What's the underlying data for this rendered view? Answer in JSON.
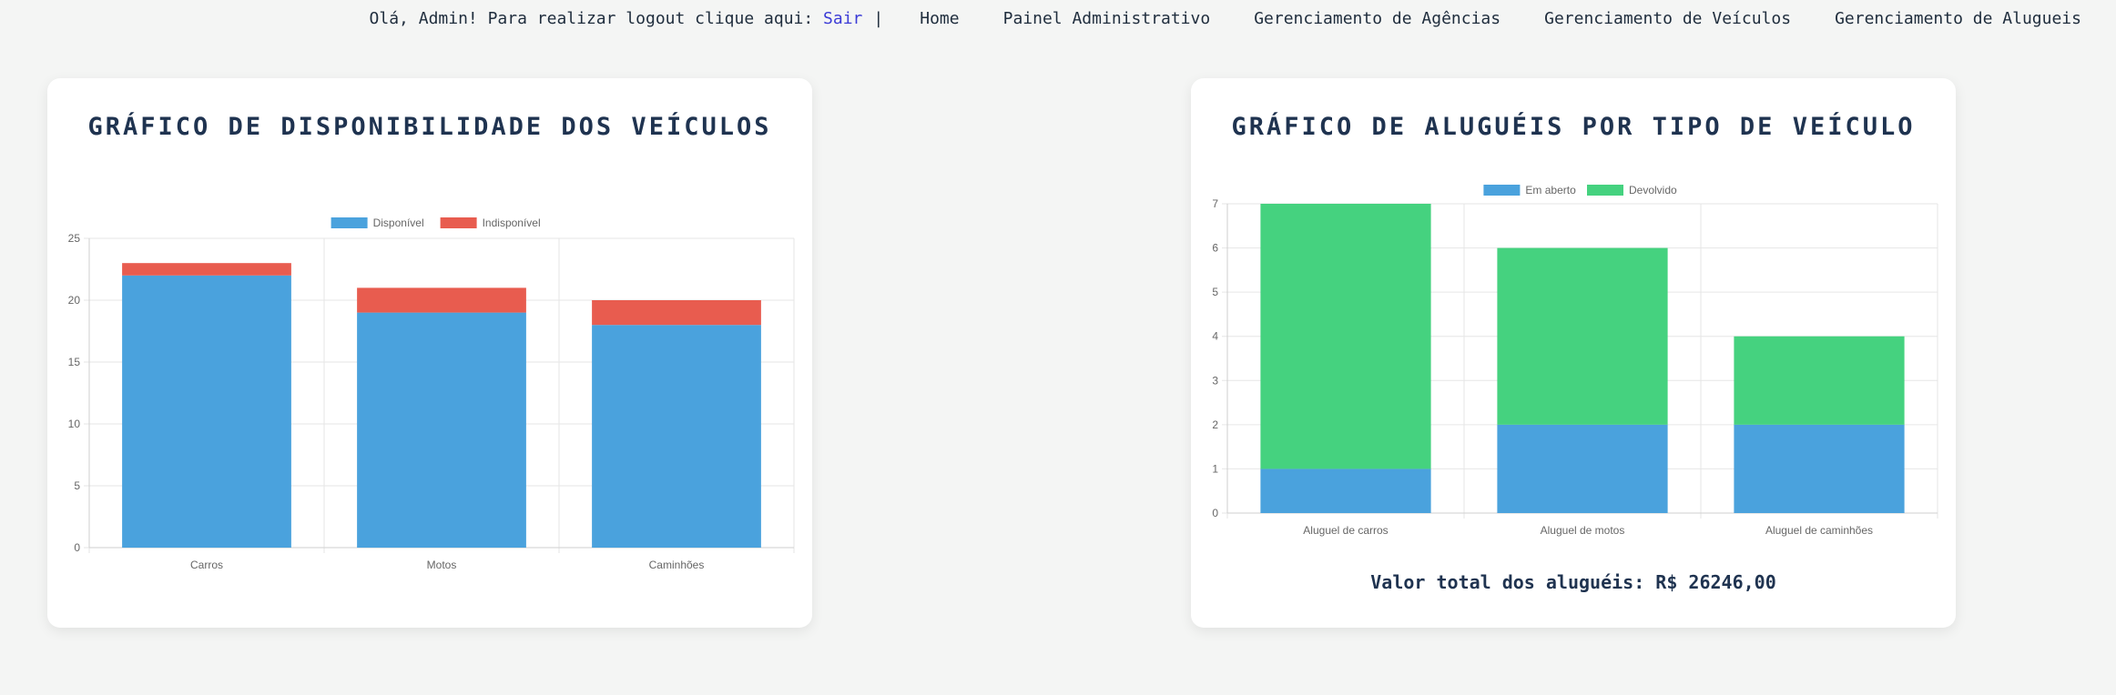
{
  "header": {
    "greeting": "Olá, Admin! Para realizar logout clique aqui: ",
    "logout_label": "Sair",
    "separator": "|",
    "nav": [
      "Home",
      "Painel Administrativo",
      "Gerenciamento de Agências",
      "Gerenciamento de Veículos",
      "Gerenciamento de Alugueis"
    ]
  },
  "colors": {
    "blue": "#4aa2dd",
    "red": "#e85c4f",
    "green": "#45d27f",
    "background": "#f4f5f4",
    "link": "#3b3bd6"
  },
  "left_card": {
    "title": "GRÁFICO DE DISPONIBILIDADE DOS VEÍCULOS"
  },
  "right_card": {
    "title": "GRÁFICO DE ALUGUÉIS POR TIPO DE VEÍCULO",
    "total_text": "Valor total dos aluguéis: R$ 26246,00"
  },
  "chart_data": [
    {
      "type": "bar",
      "stacked": true,
      "title": "GRÁFICO DE DISPONIBILIDADE DOS VEÍCULOS",
      "categories": [
        "Carros",
        "Motos",
        "Caminhões"
      ],
      "series": [
        {
          "name": "Disponível",
          "color": "#4aa2dd",
          "values": [
            22,
            19,
            18
          ]
        },
        {
          "name": "Indisponível",
          "color": "#e85c4f",
          "values": [
            1,
            2,
            2
          ]
        }
      ],
      "ylim": [
        0,
        25
      ],
      "yticks": [
        0,
        5,
        10,
        15,
        20,
        25
      ],
      "legend": "top",
      "grid": true
    },
    {
      "type": "bar",
      "stacked": true,
      "title": "GRÁFICO DE ALUGUÉIS POR TIPO DE VEÍCULO",
      "categories": [
        "Aluguel de carros",
        "Aluguel de motos",
        "Aluguel de caminhões"
      ],
      "series": [
        {
          "name": "Em aberto",
          "color": "#4aa2dd",
          "values": [
            1,
            2,
            2
          ]
        },
        {
          "name": "Devolvido",
          "color": "#45d27f",
          "values": [
            6,
            4,
            2
          ]
        }
      ],
      "ylim": [
        0,
        7
      ],
      "yticks": [
        0,
        1,
        2,
        3,
        4,
        5,
        6,
        7
      ],
      "legend": "top",
      "grid": true
    }
  ]
}
